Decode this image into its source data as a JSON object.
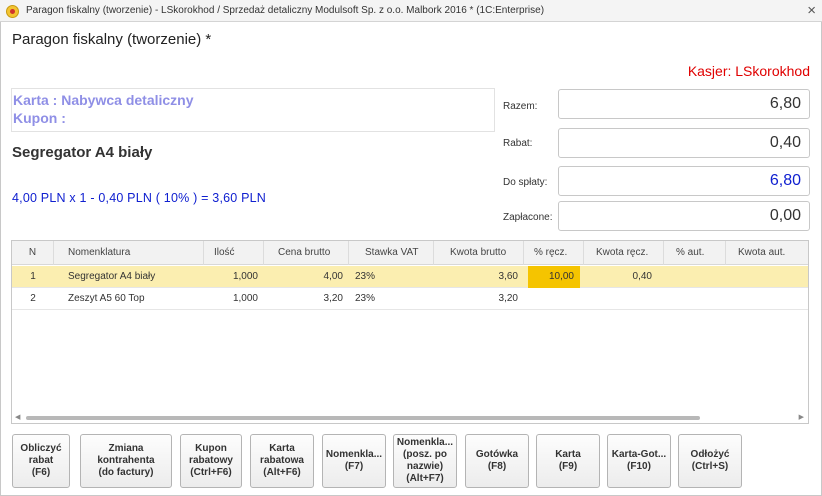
{
  "window": {
    "title": "Paragon fiskalny (tworzenie) - LSkorokhod / Sprzedaż detaliczny Modulsoft Sp. z o.o. Malbork 2016 * (1C:Enterprise)",
    "close_glyph": "×"
  },
  "form": {
    "title": "Paragon fiskalny (tworzenie) *",
    "cashier": "Kasjer: LSkorokhod",
    "card_line": "Karta : Nabywca detaliczny",
    "coupon_line": "Kupon :",
    "current_product": "Segregator A4 biały",
    "calculation": "4,00 PLN x 1 - 0,40 PLN ( 10% )  = 3,60 PLN"
  },
  "summary": {
    "razem_label": "Razem:",
    "razem_value": "6,80",
    "rabat_label": "Rabat:",
    "rabat_value": "0,40",
    "do_splaty_label": "Do spłaty:",
    "do_splaty_value": "6,80",
    "zaplacone_label": "Zapłacone:",
    "zaplacone_value": "0,00"
  },
  "table": {
    "headers": [
      "N",
      "Nomenklatura",
      "Ilość",
      "Cena brutto",
      "Stawka VAT",
      "Kwota brutto",
      "% ręcz.",
      "Kwota ręcz.",
      "% aut.",
      "Kwota aut."
    ],
    "rows": [
      {
        "n": "1",
        "name": "Segregator A4 biały",
        "qty": "1,000",
        "price": "4,00",
        "vat": "23%",
        "amount": "3,60",
        "pct_manual": "10,00",
        "amt_manual": "0,40",
        "pct_auto": "",
        "amt_auto": ""
      },
      {
        "n": "2",
        "name": "Zeszyt A5 60 Top",
        "qty": "1,000",
        "price": "3,20",
        "vat": "23%",
        "amount": "3,20",
        "pct_manual": "",
        "amt_manual": "",
        "pct_auto": "",
        "amt_auto": ""
      }
    ]
  },
  "buttons": {
    "calc_discount": "Obliczyć\nrabat\n(F6)",
    "change_contractor": "Zmiana\nkontrahenta\n(do factury)",
    "discount_coupon": "Kupon\nrabatowy\n(Ctrl+F6)",
    "discount_card": "Karta\nrabatowa\n(Alt+F6)",
    "nomenclature": "Nomenkla...\n(F7)",
    "nomenclature_by_name": "Nomenkla...\n(posz. po\nnazwie)\n(Alt+F7)",
    "cash": "Gotówka\n(F8)",
    "card": "Karta\n(F9)",
    "card_cash": "Karta-Got...\n(F10)",
    "postpone": "Odłożyć\n(Ctrl+S)"
  },
  "colors": {
    "cashier": "#e00000",
    "card_text": "#8f8fe6",
    "calc_text": "#1020d0",
    "selected_row": "#fbeeb0",
    "highlight_cell": "#f5c400"
  }
}
